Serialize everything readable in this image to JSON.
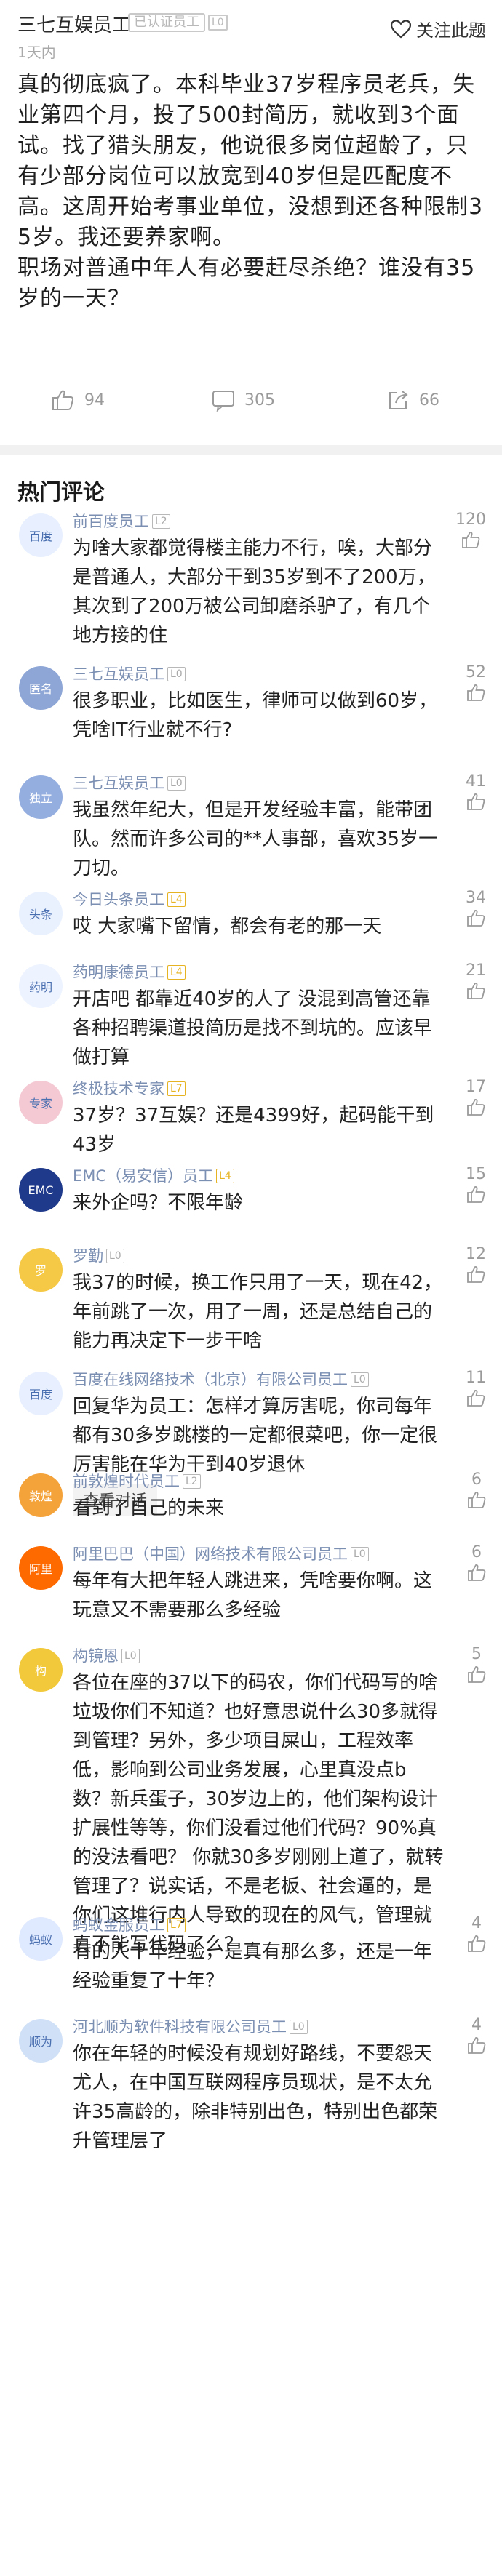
{
  "post": {
    "author": "三七互娱员工",
    "badge_text": "已认证员工",
    "level": "L0",
    "time": "1天内",
    "follow_label": "关注此题",
    "body_lines": [
      "真的彻底疯了。本科毕业37岁程序员老兵，失业第四个月，投了500封简历，就收到3个面试。找了猎头朋友，他说很多岗位超龄了，只有少部分岗位可以放宽到40岁但是匹配度不高。这周开始考事业单位，没想到还各种限制35岁。我还要养家啊。",
      "职场对普通中年人有必要赶尽杀绝？谁没有35岁的一天？"
    ],
    "likes": "94",
    "comments_count": "305",
    "shares": "66"
  },
  "section_title": "热门评论",
  "comments": [
    {
      "name": "前百度员工",
      "level": "L2",
      "avatar_label": "百度",
      "avatar_color": "#e8f0ff",
      "text": "为啥大家都觉得楼主能力不行，唉，大部分是普通人，大部分干到35岁到不了200万，其次到了200万被公司卸磨杀驴了，有几个地方接的住",
      "likes": "120"
    },
    {
      "name": "三七互娱员工",
      "level": "L0",
      "avatar_label": "匿名",
      "avatar_color": "#8ea6d6",
      "text": "很多职业，比如医生，律师可以做到60岁，凭啥IT行业就不行?",
      "likes": "52"
    },
    {
      "name": "三七互娱员工",
      "level": "L0",
      "avatar_label": "独立",
      "avatar_color": "#95aee0",
      "text": "我虽然年纪大，但是开发经验丰富，能带团队。然而许多公司的**人事部，喜欢35岁一刀切。",
      "likes": "41"
    },
    {
      "name": "今日头条员工",
      "level": "L4",
      "avatar_label": "头条",
      "avatar_color": "#e9f1ff",
      "text": "哎 大家嘴下留情，都会有老的那一天",
      "likes": "34"
    },
    {
      "name": "药明康德员工",
      "level": "L4",
      "avatar_label": "药明",
      "avatar_color": "#edf3ff",
      "text": "开店吧 都靠近40岁的人了 没混到高管还靠各种招聘渠道投简历是找不到坑的。应该早做打算",
      "likes": "21"
    },
    {
      "name": "终极技术专家",
      "level": "L7",
      "avatar_label": "专家",
      "avatar_color": "#f4c9d4",
      "text": "37岁？37互娱？还是4399好，起码能干到43岁",
      "likes": "17"
    },
    {
      "name": "EMC（易安信）员工",
      "level": "L4",
      "avatar_label": "EMC",
      "avatar_color": "#1f3a8a",
      "text": "来外企吗？不限年龄",
      "likes": "15"
    },
    {
      "name": "罗勤",
      "level": "L0",
      "avatar_label": "罗",
      "avatar_color": "#f5c945",
      "text": "我37的时候，换工作只用了一天，现在42，年前跳了一次，用了一周，还是总结自己的能力再决定下一步干啥",
      "likes": "12"
    },
    {
      "name": "百度在线网络技术（北京）有限公司员工",
      "level": "L0",
      "avatar_label": "百度",
      "avatar_color": "#e8f0ff",
      "text": "回复华为员工：怎样才算厉害呢，你司每年都有30多岁跳楼的一定都很菜吧，你一定很厉害能在华为干到40岁退休",
      "likes": "11",
      "reply": "查看对话"
    },
    {
      "name": "前敦煌时代员工",
      "level": "L2",
      "avatar_label": "敦煌",
      "avatar_color": "#f4a23a",
      "text": "看到了自己的未来",
      "likes": "6"
    },
    {
      "name": "阿里巴巴（中国）网络技术有限公司员工",
      "level": "L0",
      "avatar_label": "阿里",
      "avatar_color": "#ff6a00",
      "text": "每年有大把年轻人跳进来，凭啥要你啊。这玩意又不需要那么多经验",
      "likes": "6"
    },
    {
      "name": "构镜恩",
      "level": "L0",
      "avatar_label": "构",
      "avatar_color": "#f2c93a",
      "text": "各位在座的37以下的码农，你们代码写的啥垃圾你们不知道？也好意思说什么30多就得到管理？另外，多少项目屎山，工程效率低，影响到公司业务发展，心里真没点b数？新兵蛋子，30岁边上的，他们架构设计扩展性等等，你们没看过他们代码？90%真的没法看吧？ 你就30多岁刚刚上道了，就转管理了？说实话，不是老板、社会逼的，是你们这堆行内人导致的现在的风气，管理就真不能写代码了么？",
      "likes": "5"
    },
    {
      "name": "蚂蚁金服员工",
      "level": "L7",
      "avatar_label": "蚂蚁",
      "avatar_color": "#dfe9ff",
      "text": "有的人十年经验，是真有那么多，还是一年经验重复了十年？",
      "likes": "4"
    },
    {
      "name": "河北顺为软件科技有限公司员工",
      "level": "L0",
      "avatar_label": "顺为",
      "avatar_color": "#cfe0f7",
      "text": "你在年轻的时候没有规划好路线，不要怨天尤人，在中国互联网程序员现状，是不太允许35高龄的，除非特别出色，特别出色都荣升管理层了",
      "likes": "4"
    }
  ]
}
